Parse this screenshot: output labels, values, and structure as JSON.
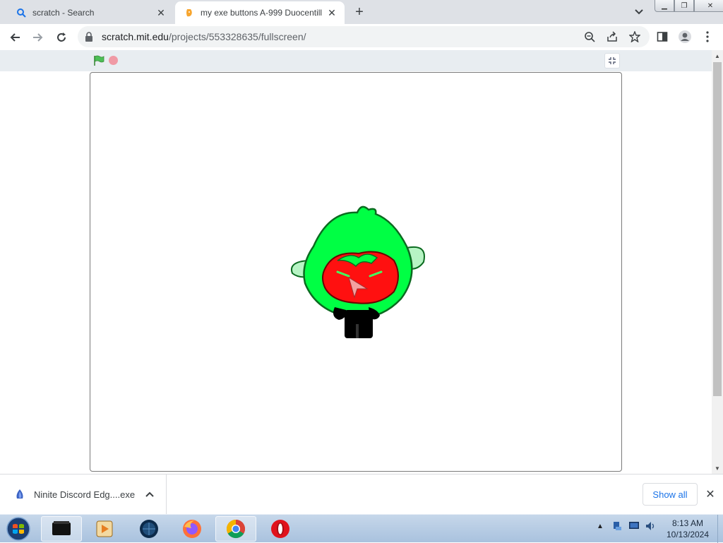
{
  "browser": {
    "tabs": [
      {
        "title": "scratch - Search",
        "icon": "search-icon",
        "active": false
      },
      {
        "title": "my exe buttons A-999 Duocentill",
        "icon": "scratch-cat-icon",
        "active": true
      }
    ],
    "new_tab_label": "+",
    "address": {
      "host": "scratch.mit.edu",
      "path": "/projects/553328635/fullscreen/"
    }
  },
  "player": {
    "green_flag_icon": "green-flag-icon",
    "stop_icon": "stop-sign-icon",
    "unfullscreen_icon": "unfullscreen-icon"
  },
  "downloads": {
    "item_name": "Ninite Discord Edg....exe",
    "show_all_label": "Show all"
  },
  "taskbar": {
    "items": [
      "cmd-icon",
      "media-player-icon",
      "globe-icon",
      "firefox-icon",
      "chrome-icon",
      "opera-icon"
    ],
    "time": "8:13 AM",
    "date": "10/13/2024"
  },
  "colors": {
    "tabstrip": "#dee1e6",
    "sprite_body": "#00ff44",
    "sprite_face": "#ff0000",
    "link_blue": "#1a73e8"
  }
}
